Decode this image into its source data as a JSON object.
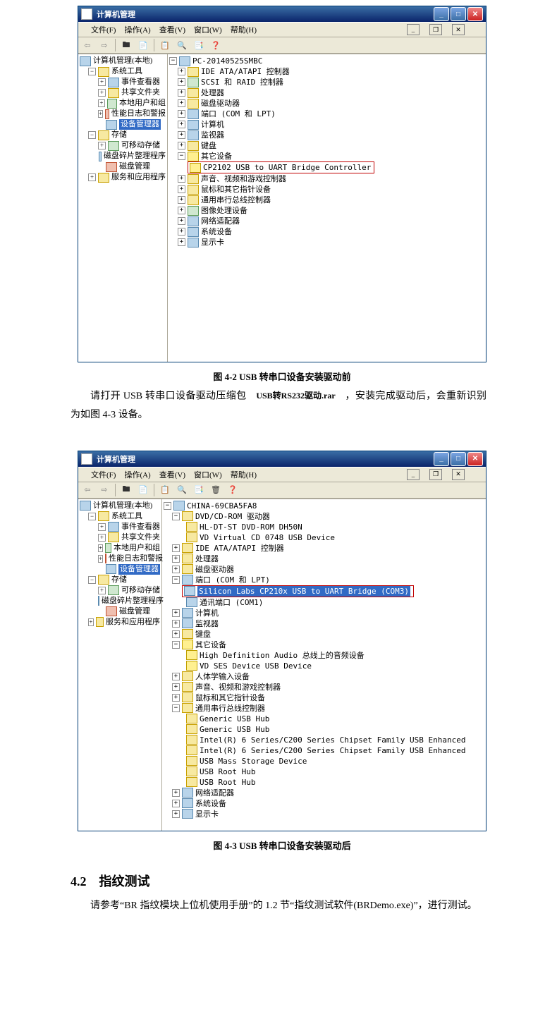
{
  "fig1": {
    "title": "计算机管理",
    "menu": [
      "文件(F)",
      "操作(A)",
      "查看(V)",
      "窗口(W)",
      "帮助(H)"
    ],
    "left_root": "计算机管理(本地)",
    "left_systools": "系统工具",
    "left_items": [
      "事件查看器",
      "共享文件夹",
      "本地用户和组",
      "性能日志和警报"
    ],
    "left_sel": "设备管理器",
    "left_storage": "存储",
    "left_storage_items": [
      "可移动存储",
      "磁盘碎片整理程序",
      "磁盘管理"
    ],
    "left_service": "服务和应用程序",
    "right_root": "PC-20140525SMBC",
    "r1": "IDE ATA/ATAPI 控制器",
    "r2": "SCSI 和 RAID 控制器",
    "r3": "处理器",
    "r4": "磁盘驱动器",
    "r5": "端口 (COM 和 LPT)",
    "r6": "计算机",
    "r7": "监视器",
    "r8": "键盘",
    "r9": "其它设备",
    "r9a": "CP2102 USB to UART Bridge Controller",
    "r10": "声音、视频和游戏控制器",
    "r11": "鼠标和其它指针设备",
    "r12": "通用串行总线控制器",
    "r13": "图像处理设备",
    "r14": "网络适配器",
    "r15": "系统设备",
    "r16": "显示卡",
    "caption": "图 4-2 USB 转串口设备安装驱动前"
  },
  "rar_label": "USB转RS232驱动.rar",
  "para1a": "请打开 USB 转串口设备驱动压缩包",
  "para1b": "，安装完成驱动后，会重新识别为如图 4-3 设备。",
  "fig2": {
    "title": "计算机管理",
    "menu": [
      "文件(F)",
      "操作(A)",
      "查看(V)",
      "窗口(W)",
      "帮助(H)"
    ],
    "left_root": "计算机管理(本地)",
    "left_systools": "系统工具",
    "left_items": [
      "事件查看器",
      "共享文件夹",
      "本地用户和组",
      "性能日志和警报"
    ],
    "left_sel": "设备管理器",
    "left_storage": "存储",
    "left_storage_items": [
      "可移动存储",
      "磁盘碎片整理程序",
      "磁盘管理"
    ],
    "left_service": "服务和应用程序",
    "right_root": "CHINA-69CBA5FA8",
    "dvdcat": "DVD/CD-ROM 驱动器",
    "dvd1": "HL-DT-ST DVD-ROM DH50N",
    "dvd2": "VD Virtual CD 0748 USB Device",
    "ide": "IDE ATA/ATAPI 控制器",
    "cpu": "处理器",
    "disk": "磁盘驱动器",
    "ports": "端口 (COM 和 LPT)",
    "port_sel": "Silicon Labs CP210x USB to UART Bridge (COM3)",
    "port_com1": "通讯端口 (COM1)",
    "pc": "计算机",
    "mon": "监视器",
    "kb": "键盘",
    "other": "其它设备",
    "other1": "High Definition Audio 总线上的音频设备",
    "other2": "VD SES Device USB Device",
    "hid": "人体学输入设备",
    "snd": "声音、视频和游戏控制器",
    "mouse": "鼠标和其它指针设备",
    "usb": "通用串行总线控制器",
    "usb1": "Generic USB Hub",
    "usb2": "Generic USB Hub",
    "usb3": "Intel(R) 6 Series/C200 Series Chipset Family USB Enhanced",
    "usb4": "Intel(R) 6 Series/C200 Series Chipset Family USB Enhanced",
    "usb5": "USB Mass Storage Device",
    "usb6": "USB Root Hub",
    "usb7": "USB Root Hub",
    "net": "网络适配器",
    "sys": "系统设备",
    "disp": "显示卡",
    "caption": "图 4-3 USB 转串口设备安装驱动后"
  },
  "sec_title": "4.2　指纹测试",
  "para2": "请参考“BR 指纹模块上位机使用手册”的 1.2 节“指纹测试软件(BRDemo.exe)”，进行测试。"
}
